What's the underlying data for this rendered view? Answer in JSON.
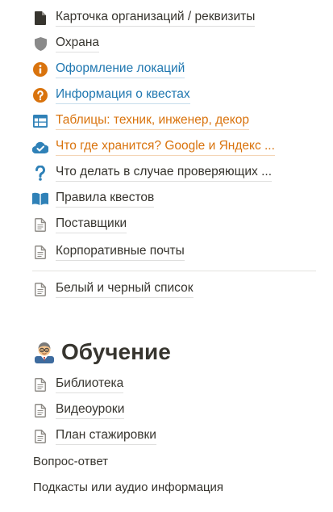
{
  "links": [
    {
      "label": "Карточка организаций / реквизиты",
      "icon": "document-filled-icon"
    },
    {
      "label": "Охрана",
      "icon": "shield-icon"
    },
    {
      "label": "Оформление локаций",
      "icon": "info-circle-icon",
      "color": "#d9730d"
    },
    {
      "label": "Информация о квестах",
      "icon": "question-circle-icon",
      "color": "#d9730d"
    },
    {
      "label": "Таблицы: техник, инженер, декор",
      "icon": "table-icon",
      "color": "#2f81b7"
    },
    {
      "label": "Что где хранится? Google и Яндекс ...",
      "icon": "cloud-download-icon",
      "color": "#2f81b7"
    },
    {
      "label": "Что делать в случае проверяющих ...",
      "icon": "question-mark-icon",
      "color": "#2f81b7"
    },
    {
      "label": "Правила квестов",
      "icon": "open-book-icon",
      "color": "#2f81b7"
    },
    {
      "label": "Поставщики",
      "icon": "page-icon"
    },
    {
      "label": "Корпоративные почты",
      "icon": "page-icon"
    },
    {
      "label": "Белый и черный список",
      "icon": "page-icon"
    }
  ],
  "section": {
    "title": "Обучение",
    "emoji": "teacher-emoji-icon",
    "links": [
      {
        "label": "Библиотека",
        "icon": "page-icon"
      },
      {
        "label": "Видеоуроки",
        "icon": "page-icon"
      },
      {
        "label": "План стажировки",
        "icon": "page-icon"
      }
    ],
    "text": [
      "Вопрос-ответ",
      "Подкасты или аудио информация"
    ]
  },
  "colors": {
    "text": "#37352f",
    "blue_link": "#1f77b0",
    "orange_link": "#d9730d",
    "divider": "#e3e2df"
  }
}
